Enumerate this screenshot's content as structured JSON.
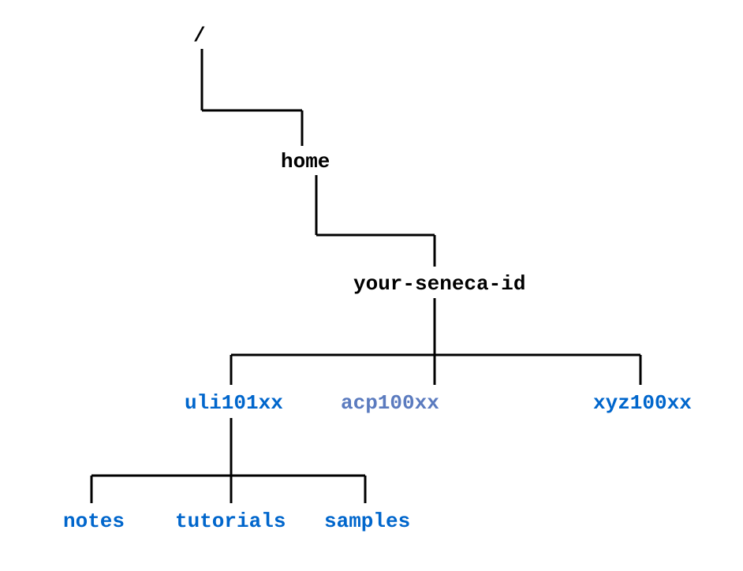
{
  "tree": {
    "root": "/",
    "home": "home",
    "user": "your-seneca-id",
    "courses": {
      "uli": "uli101xx",
      "acp": "acp100xx",
      "xyz": "xyz100xx"
    },
    "uli_children": {
      "notes": "notes",
      "tutorials": "tutorials",
      "samples": "samples"
    }
  },
  "colors": {
    "text": "#000000",
    "link": "#0066cc",
    "link_muted": "#5b7bbf"
  }
}
